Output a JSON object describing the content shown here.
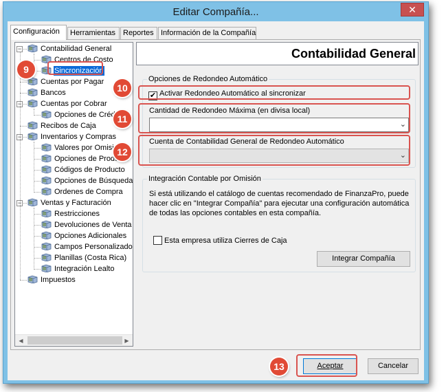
{
  "window": {
    "title": "Editar Compañía...",
    "close_label": "✕"
  },
  "tabs": [
    "Configuración",
    "Herramientas",
    "Reportes",
    "Información de la Compañía"
  ],
  "tree": [
    {
      "label": "Contabilidad General",
      "level": 0,
      "expander": "−"
    },
    {
      "label": "Centros de Costo",
      "level": 1
    },
    {
      "label": "Sincronización",
      "level": 1,
      "selected": true
    },
    {
      "label": "Cuentas por Pagar",
      "level": 0
    },
    {
      "label": "Bancos",
      "level": 0
    },
    {
      "label": "Cuentas por Cobrar",
      "level": 0,
      "expander": "−"
    },
    {
      "label": "Opciones de Crédito",
      "level": 1
    },
    {
      "label": "Recibos de Caja",
      "level": 0
    },
    {
      "label": "Inventarios y Compras",
      "level": 0,
      "expander": "−"
    },
    {
      "label": "Valores por Omisión",
      "level": 1
    },
    {
      "label": "Opciones de Producto",
      "level": 1
    },
    {
      "label": "Códigos de Producto",
      "level": 1
    },
    {
      "label": "Opciones de Búsqueda",
      "level": 1
    },
    {
      "label": "Ordenes de Compra",
      "level": 1
    },
    {
      "label": "Ventas y Facturación",
      "level": 0,
      "expander": "−"
    },
    {
      "label": "Restricciones",
      "level": 1
    },
    {
      "label": "Devoluciones de Venta",
      "level": 1
    },
    {
      "label": "Opciones Adicionales",
      "level": 1
    },
    {
      "label": "Campos Personalizados",
      "level": 1
    },
    {
      "label": "Planillas (Costa Rica)",
      "level": 1
    },
    {
      "label": "Integración Lealto",
      "level": 1
    },
    {
      "label": "Impuestos",
      "level": 0
    }
  ],
  "panel": {
    "title": "Contabilidad General",
    "rounding_group": {
      "legend": "Opciones de Redondeo Automático",
      "auto_round_checkbox": {
        "label": "Activar Redondeo Automático al sincronizar",
        "checked": true
      },
      "max_amount_label": "Cantidad de Redondeo Máxima (en divisa local)",
      "max_amount_value": "",
      "account_label": "Cuenta de Contabilidad General de Redondeo Automático",
      "account_value": ""
    },
    "integration_group": {
      "legend": "Integración Contable por Omisión",
      "description": "Si está utilizando el catálogo de cuentas recomendado de FinanzaPro, puede hacer clic en \"Integrar Compañía\" para ejecutar una configuración automática de todas las opciones contables en esta compañía.",
      "cash_close_checkbox": {
        "label": "Esta empresa utiliza Cierres de Caja",
        "checked": false
      },
      "integrate_button": "Integrar Compañía"
    }
  },
  "footer": {
    "accept_button": "Aceptar",
    "cancel_button": "Cancelar"
  },
  "annotations": [
    "9",
    "10",
    "11",
    "12",
    "13"
  ],
  "colors": {
    "accent": "#e14a35",
    "selection": "#0a6ad8",
    "titlebar": "#7fc1e6",
    "close": "#c75050"
  }
}
